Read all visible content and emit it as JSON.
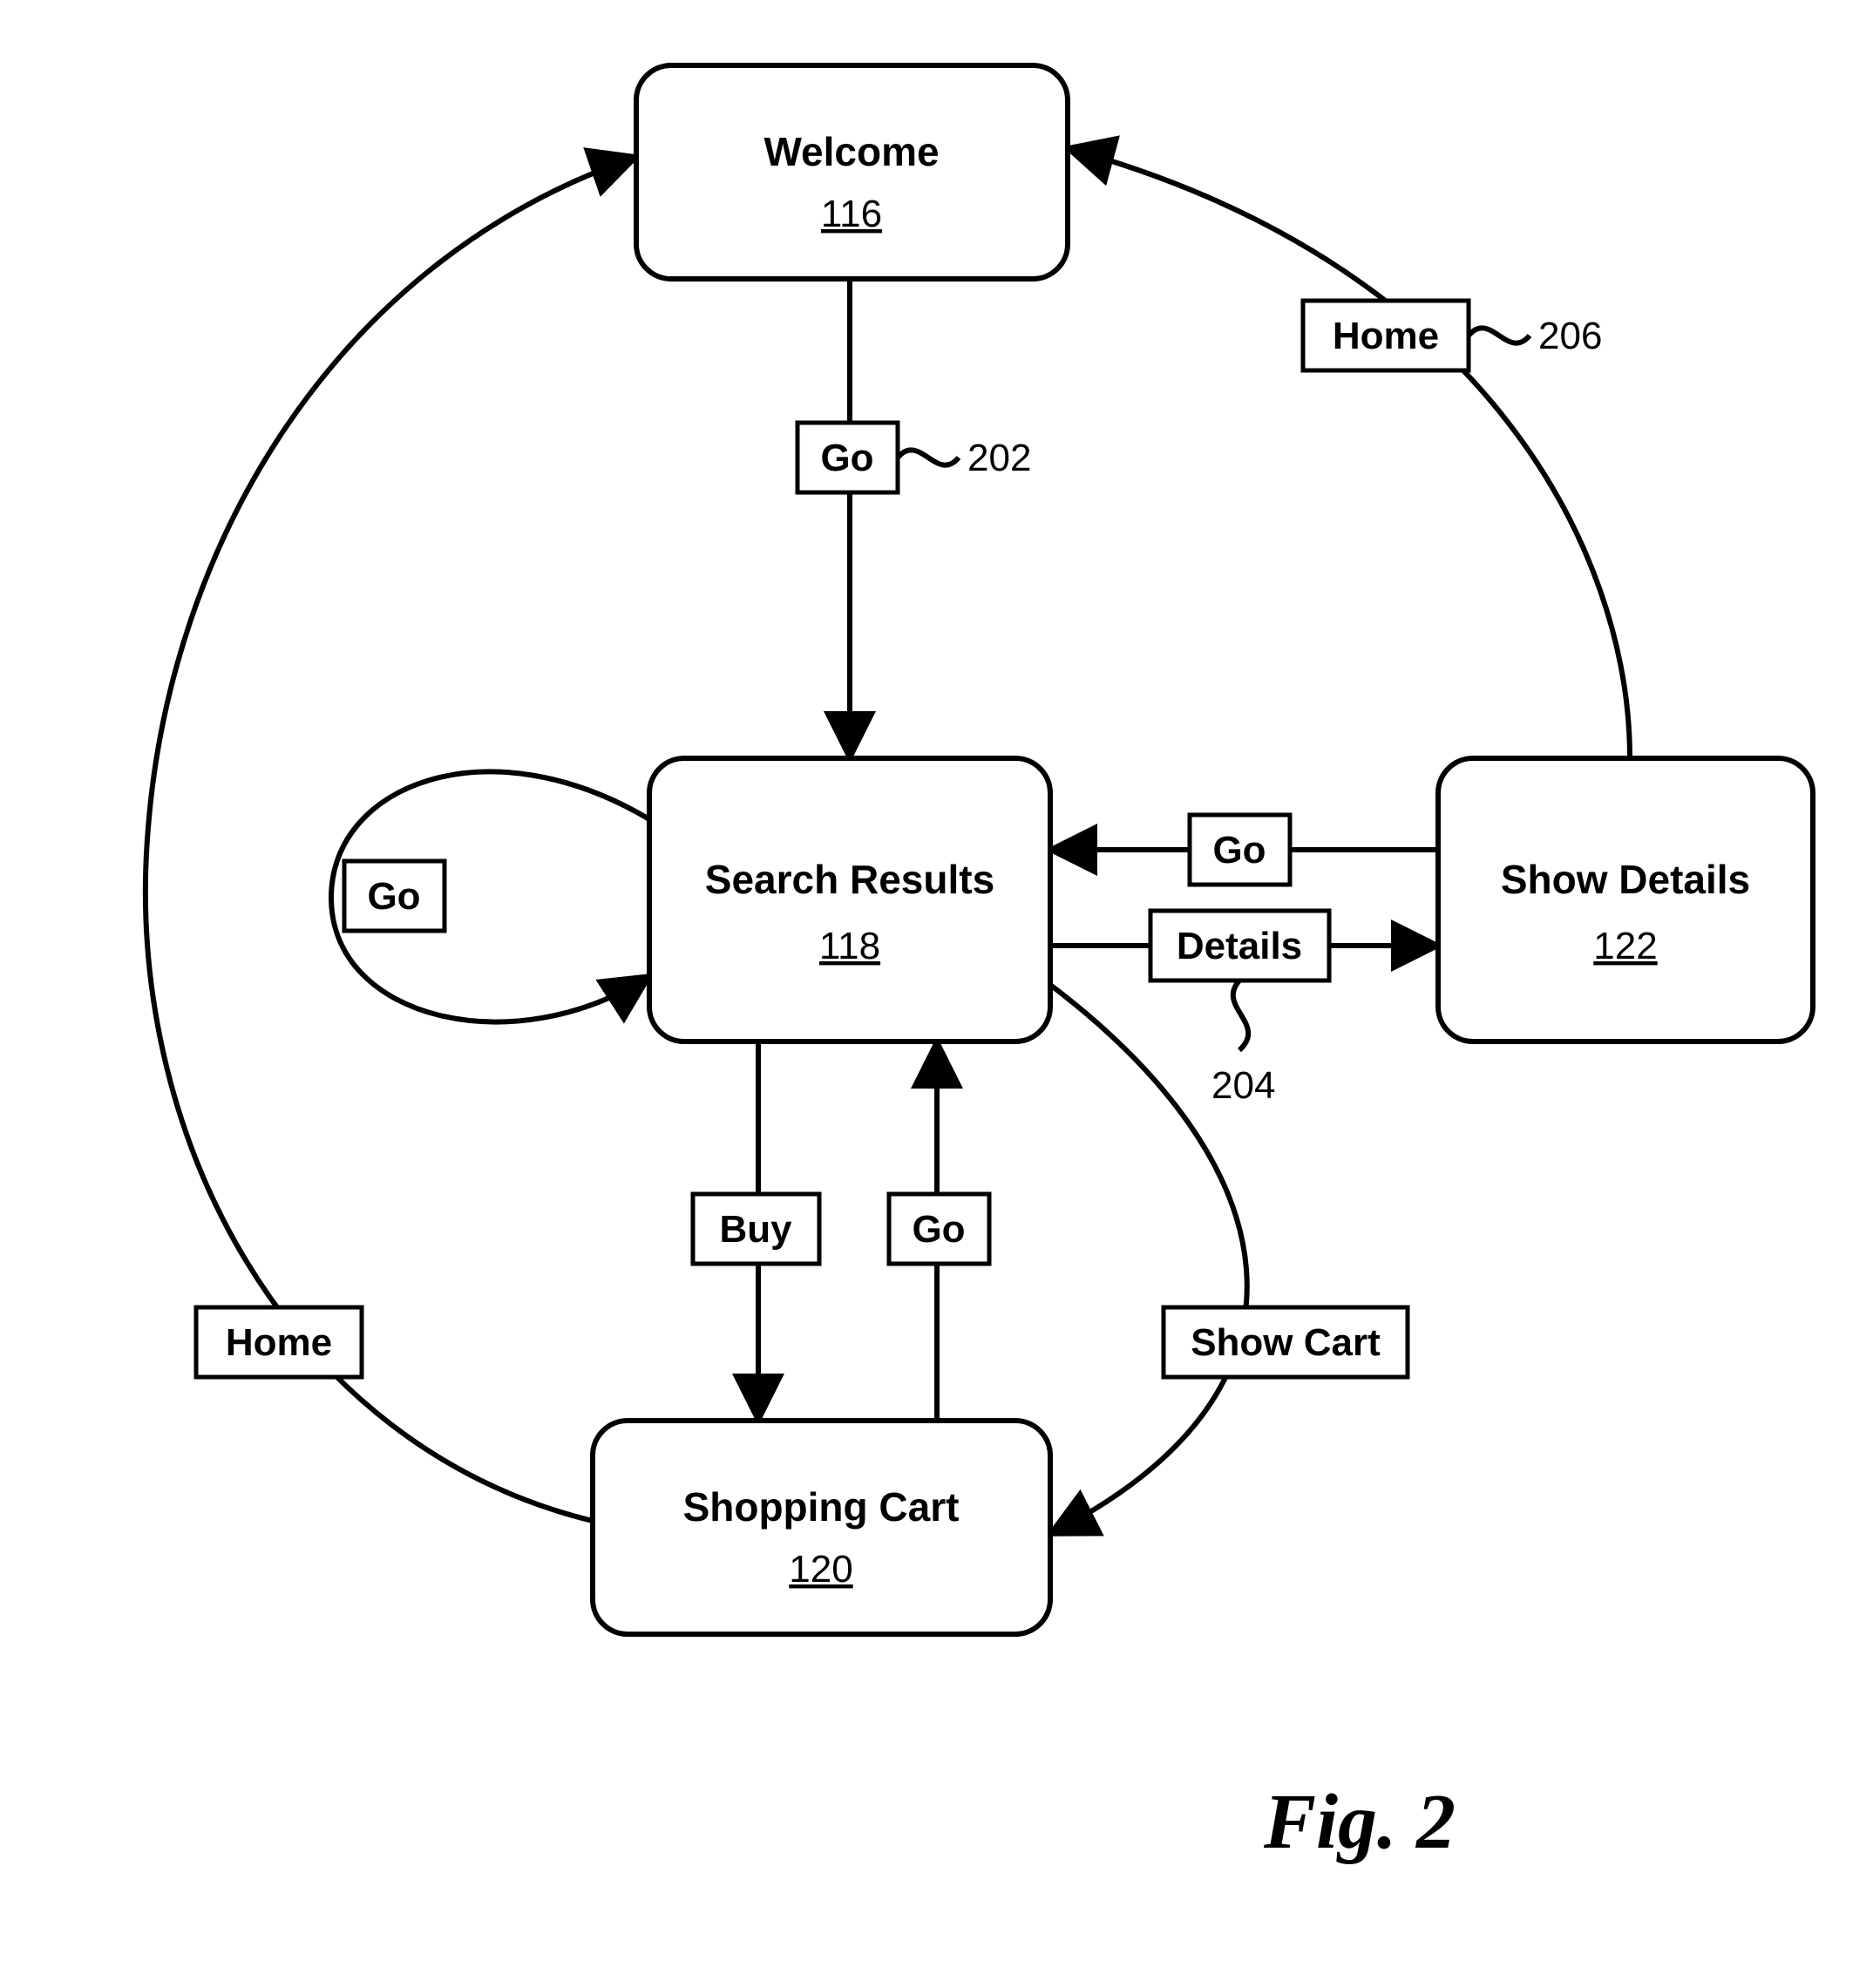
{
  "figure_caption": "Fig. 2",
  "nodes": {
    "welcome": {
      "title": "Welcome",
      "ref": "116"
    },
    "searchResults": {
      "title": "Search Results",
      "ref": "118"
    },
    "shoppingCart": {
      "title": "Shopping Cart",
      "ref": "120"
    },
    "showDetails": {
      "title": "Show Details",
      "ref": "122"
    }
  },
  "edge_labels": {
    "go_welcome_to_results": "Go",
    "go_self_results": "Go",
    "go_details_to_results": "Go",
    "details_results_to_details": "Details",
    "buy_results_to_cart": "Buy",
    "go_cart_to_results": "Go",
    "home_cart_to_welcome": "Home",
    "home_details_to_welcome": "Home",
    "showcart_details_to_cart": "Show Cart"
  },
  "refs": {
    "go_ref": "202",
    "details_ref": "204",
    "home_ref": "206"
  }
}
